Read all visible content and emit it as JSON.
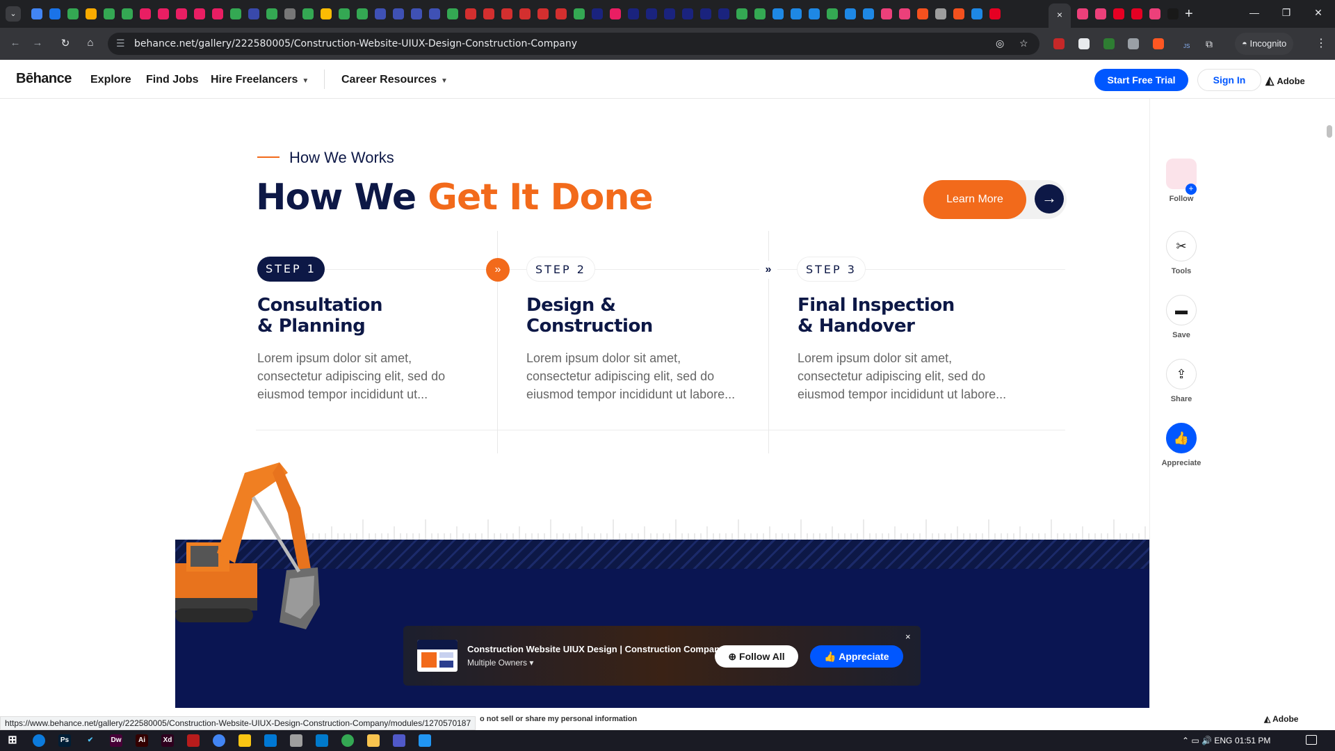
{
  "browser": {
    "url": "behance.net/gallery/222580005/Construction-Website-UIUX-Design-Construction-Company",
    "incognito_label": "Incognito",
    "extension_badge": "JS",
    "active_tab_close": "×",
    "new_tab": "+",
    "tab_colors": [
      "#4285f4",
      "#1a73e8",
      "#34a853",
      "#f9ab00",
      "#34a853",
      "#34a853",
      "#e91e63",
      "#e91e63",
      "#e91e63",
      "#e91e63",
      "#e91e63",
      "#34a853",
      "#3949ab",
      "#34a853",
      "#777777",
      "#34a853",
      "#fbbc04",
      "#34a853",
      "#34a853",
      "#3f51b5",
      "#3f51b5",
      "#3f51b5",
      "#3f51b5",
      "#34a853",
      "#d32f2f",
      "#d32f2f",
      "#d32f2f",
      "#d32f2f",
      "#d32f2f",
      "#d32f2f",
      "#34a853",
      "#1a237e",
      "#e91e63",
      "#1a237e",
      "#1a237e",
      "#1a237e",
      "#1a237e",
      "#1a237e",
      "#1a237e",
      "#34a853",
      "#34a853",
      "#1e88e5",
      "#1e88e5",
      "#1e88e5",
      "#34a853",
      "#1e88e5",
      "#1e88e5",
      "#ec407a",
      "#ec407a",
      "#f4511e",
      "#9e9e9e",
      "#f4511e",
      "#1e88e5",
      "#e60023"
    ],
    "tab_colors_right": [
      "#ec407a",
      "#ec407a",
      "#e60023",
      "#e60023",
      "#ec407a",
      "#191919"
    ]
  },
  "behance_nav": {
    "logo": "Bēhance",
    "items": [
      "Explore",
      "Find Jobs",
      "Hire Freelancers",
      "Career Resources"
    ],
    "start_trial": "Start Free Trial",
    "sign_in": "Sign In",
    "adobe": "Adobe"
  },
  "section": {
    "eyebrow": "How We Works",
    "headline_dark": "How We ",
    "headline_orange": "Get It Done",
    "learn_more": "Learn More",
    "steps": [
      {
        "label": "STEP 1",
        "title_line1": "Consultation",
        "title_line2": "& Planning",
        "body": "Lorem ipsum dolor sit amet, consectetur adipiscing elit, sed do eiusmod tempor incididunt ut..."
      },
      {
        "label": "STEP 2",
        "title_line1": "Design &",
        "title_line2": "Construction",
        "body": "Lorem ipsum dolor sit amet, consectetur adipiscing elit, sed do eiusmod tempor incididunt ut labore..."
      },
      {
        "label": "STEP 3",
        "title_line1": "Final Inspection",
        "title_line2": "& Handover",
        "body": "Lorem ipsum dolor sit amet, consectetur adipiscing elit, sed do eiusmod tempor incididunt ut labore..."
      }
    ]
  },
  "floating_bar": {
    "title": "Construction Website UIUX Design | Construction Company",
    "owners": "Multiple Owners",
    "follow_all": "Follow All",
    "appreciate": "Appreciate",
    "close": "×"
  },
  "right_rail": {
    "follow": "Follow",
    "tools": "Tools",
    "save": "Save",
    "share": "Share",
    "appreciate": "Appreciate"
  },
  "status_bar": {
    "hover_url": "https://www.behance.net/gallery/222580005/Construction-Website-UIUX-Design-Construction-Company/modules/1270570187",
    "do_not_sell": "o not sell or share my personal information",
    "adobe": "Adobe"
  },
  "taskbar": {
    "language": "ENG",
    "time": "01:51 PM",
    "apps": [
      {
        "name": "Ps",
        "color": "#001e36"
      },
      {
        "name": "Dw",
        "color": "#470137"
      },
      {
        "name": "Ai",
        "color": "#330000"
      },
      {
        "name": "Xd",
        "color": "#2e001e"
      }
    ]
  },
  "colors": {
    "navy": "#0d1846",
    "orange": "#f26a1b",
    "behance_blue": "#0057ff"
  }
}
